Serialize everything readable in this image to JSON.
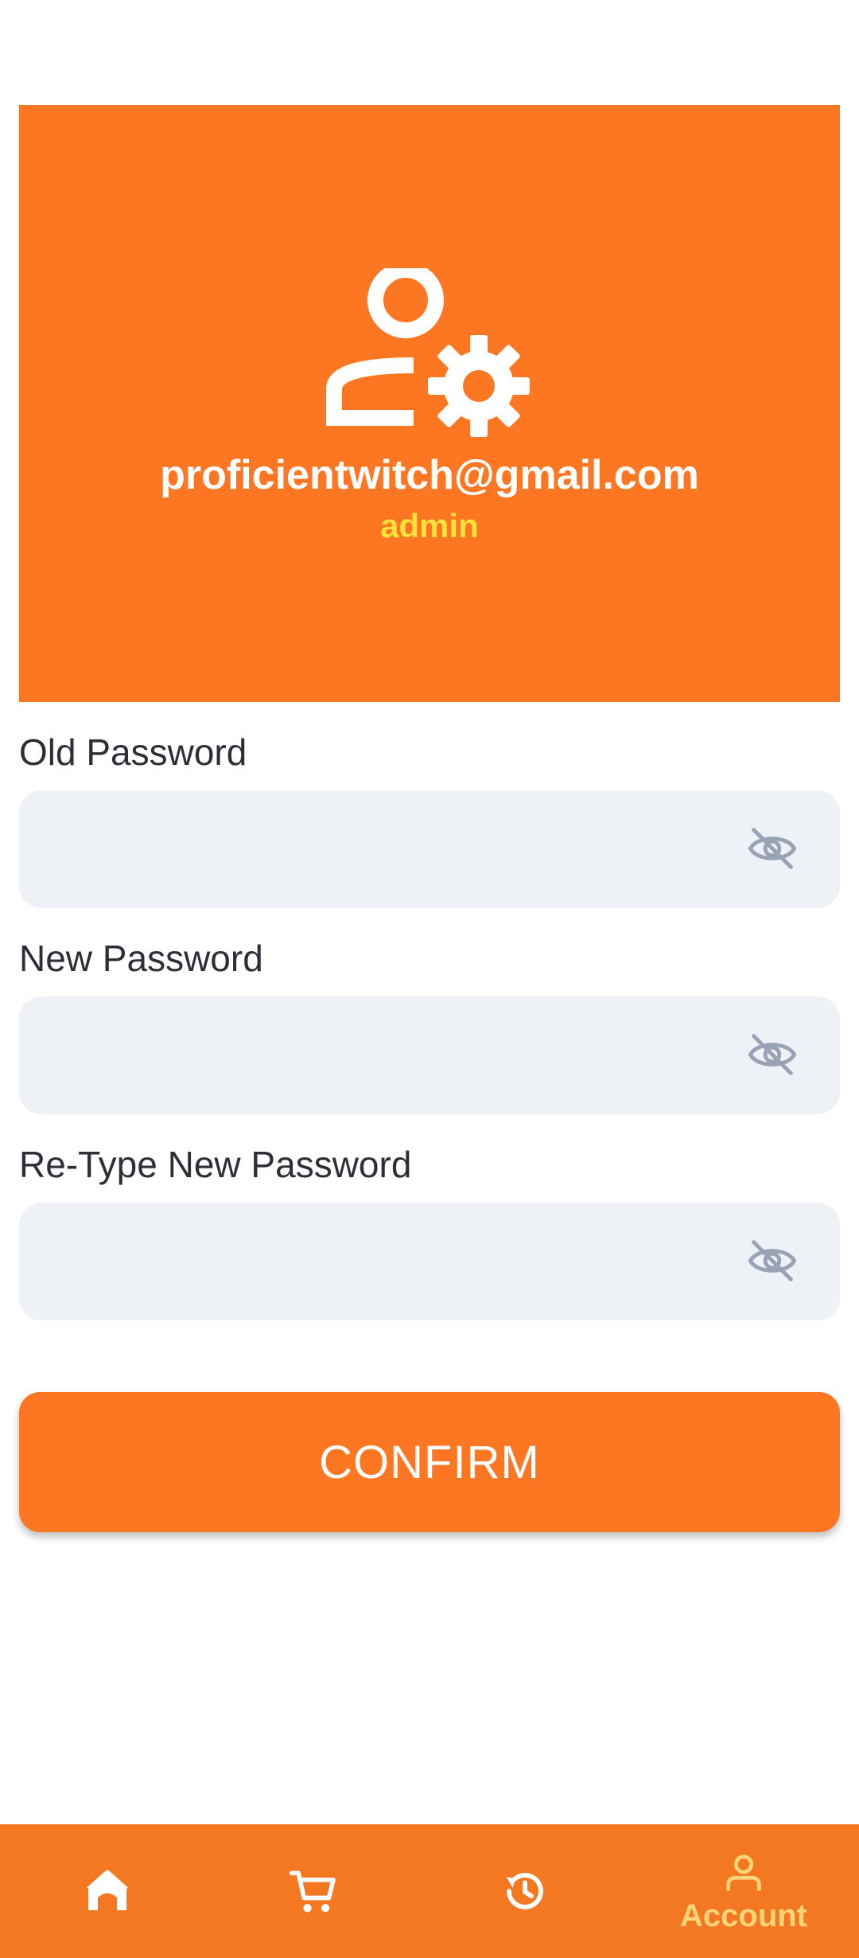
{
  "profile": {
    "email": "proficientwitch@gmail.com",
    "role": "admin",
    "icon": "admin-settings-icon"
  },
  "form": {
    "old_password_label": "Old Password",
    "new_password_label": "New Password",
    "retype_password_label": "Re-Type New Password",
    "visibility_icon": "eye-off-icon",
    "confirm_label": "CONFIRM"
  },
  "bottom_nav": {
    "items": [
      {
        "icon": "home-icon",
        "label": ""
      },
      {
        "icon": "cart-icon",
        "label": ""
      },
      {
        "icon": "history-icon",
        "label": ""
      },
      {
        "icon": "account-icon",
        "label": "Account",
        "active": true
      }
    ]
  },
  "colors": {
    "accent": "#FD7723",
    "role_text": "#FFE23A",
    "active_nav": "#FAD478",
    "input_bg": "#EEF2F7"
  }
}
